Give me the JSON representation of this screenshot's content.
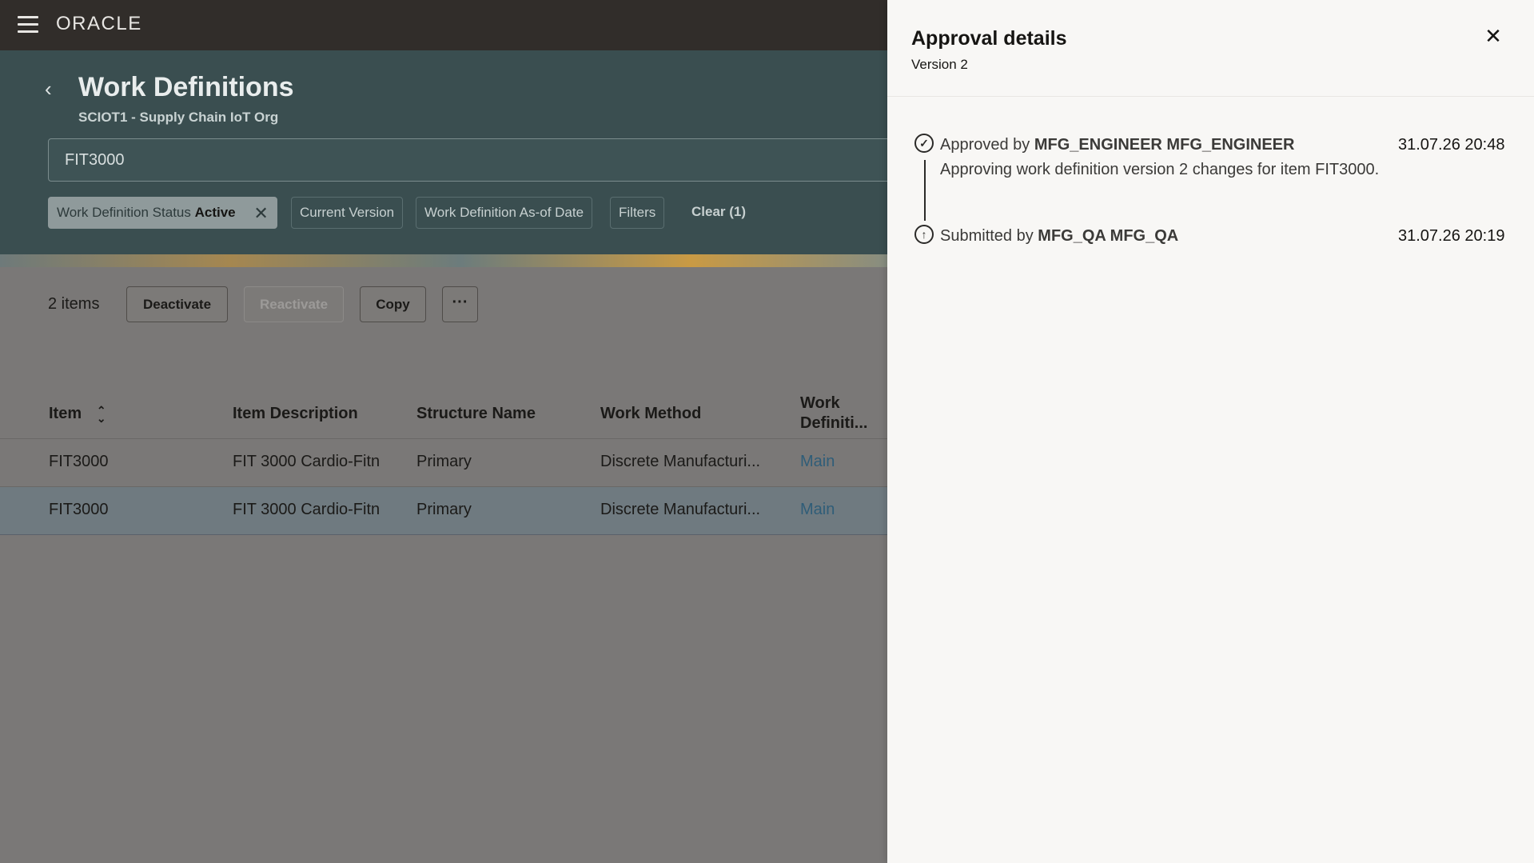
{
  "topbar": {
    "logo": "ORACLE"
  },
  "header": {
    "title": "Work Definitions",
    "subtitle": "SCIOT1 - Supply Chain IoT Org",
    "search_value": "FIT3000"
  },
  "filters": {
    "status_label": "Work Definition Status",
    "status_value": "Active",
    "current_version": "Current Version",
    "as_of_date": "Work Definition As-of Date",
    "filters": "Filters",
    "clear": "Clear (1)"
  },
  "toolbar": {
    "count": "2 items",
    "deactivate": "Deactivate",
    "reactivate": "Reactivate",
    "copy": "Copy",
    "more": "···"
  },
  "table": {
    "columns": [
      "Item",
      "Item Description",
      "Structure Name",
      "Work Method",
      "Work Definiti..."
    ],
    "column_work_line1": "Work",
    "rows": [
      {
        "item": "FIT3000",
        "description": "FIT 3000 Cardio-Fitn",
        "structure": "Primary",
        "method": "Discrete Manufacturi...",
        "work_def": "Main"
      },
      {
        "item": "FIT3000",
        "description": "FIT 3000 Cardio-Fitn",
        "structure": "Primary",
        "method": "Discrete Manufacturi...",
        "work_def": "Main"
      }
    ]
  },
  "drawer": {
    "title": "Approval details",
    "subtitle": "Version 2",
    "timeline": [
      {
        "prefix": "Approved by",
        "user": "MFG_ENGINEER MFG_ENGINEER",
        "date": "31.07.26 20:48",
        "comment": "Approving work definition version 2 changes for item FIT3000.",
        "icon": "check-circle-icon"
      },
      {
        "prefix": "Submitted by",
        "user": "MFG_QA MFG_QA",
        "date": "31.07.26 20:19",
        "comment": "",
        "icon": "upload-circle-icon"
      }
    ]
  },
  "colors": {
    "topbar": "#312d2a",
    "header": "#3a4e50",
    "drawer_bg": "#f8f7f5",
    "link": "#2f5d78"
  }
}
